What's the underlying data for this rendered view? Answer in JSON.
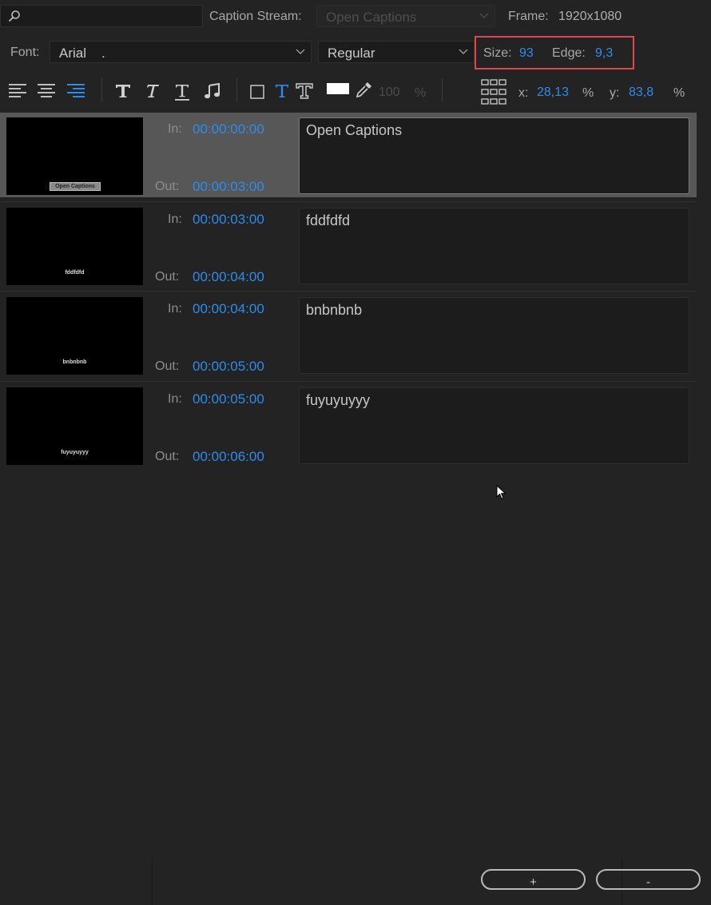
{
  "search": {
    "placeholder": ""
  },
  "caption_stream": {
    "label": "Caption Stream:",
    "value": "Open Captions"
  },
  "frame": {
    "label": "Frame:",
    "value": "1920x1080"
  },
  "font": {
    "label": "Font:",
    "family": "Arial",
    "family_suffix": ".",
    "style": "Regular"
  },
  "size": {
    "label": "Size:",
    "value": "93"
  },
  "edge": {
    "label": "Edge:",
    "value": "9,3"
  },
  "toolbar": {
    "opacity_value": "100",
    "opacity_unit": "%",
    "x_label": "x:",
    "x_value": "28,13",
    "x_unit": "%",
    "y_label": "y:",
    "y_value": "83,8",
    "y_unit": "%"
  },
  "captions": [
    {
      "in_label": "In:",
      "in": "00:00:00:00",
      "out_label": "Out:",
      "out": "00:00:03:00",
      "text": "Open Captions",
      "thumb_text": "Open Captions",
      "selected": true
    },
    {
      "in_label": "In:",
      "in": "00:00:03:00",
      "out_label": "Out:",
      "out": "00:00:04:00",
      "text": "fddfdfd",
      "thumb_text": "fddfdfd"
    },
    {
      "in_label": "In:",
      "in": "00:00:04:00",
      "out_label": "Out:",
      "out": "00:00:05:00",
      "text": "bnbnbnb",
      "thumb_text": "bnbnbnb"
    },
    {
      "in_label": "In:",
      "in": "00:00:05:00",
      "out_label": "Out:",
      "out": "00:00:06:00",
      "text": "fuyuyuyyy",
      "thumb_text": "fuyuyuyyy"
    }
  ],
  "buttons": {
    "add": "+",
    "remove": "-"
  },
  "colors": {
    "accent": "#2d8ceb",
    "highlight": "#e0474c",
    "background": "#232323"
  }
}
